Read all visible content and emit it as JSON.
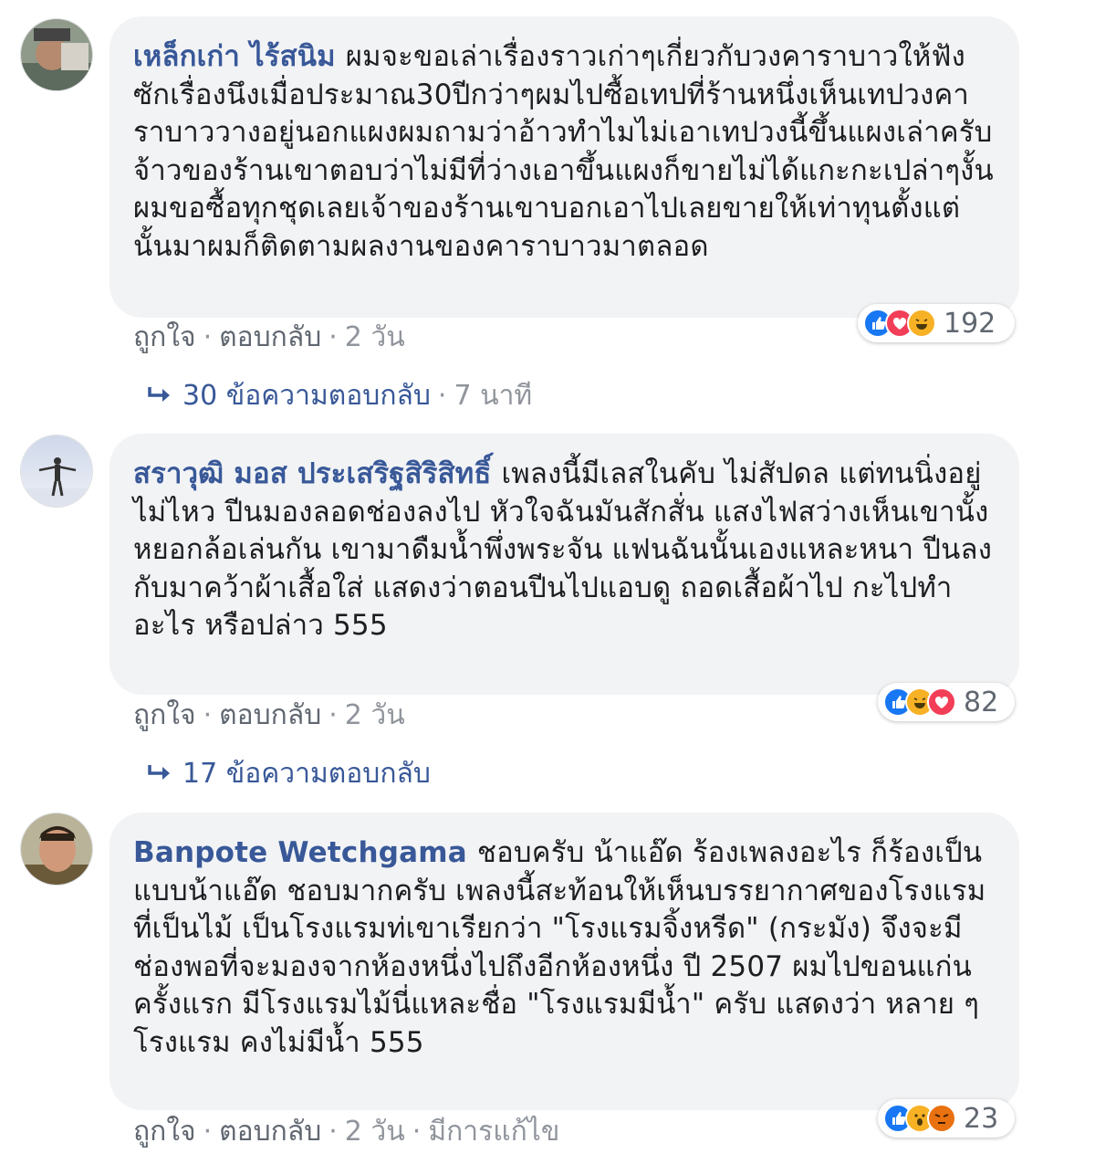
{
  "comments": [
    {
      "author": "เหล็กเก่า ไร้สนิม",
      "text": "ผมจะขอเล่าเรื่องราวเก่าๆเกี่ยวกับวงคาราบาวให้ฟังซักเรื่องนึงเมื่อประมาณ30ปีกว่าๆผมไปซื้อเทปที่ร้านหนึ่งเห็นเทปวงคาราบาววางอยู่นอกแผงผมถามว่าอ้าวทำไมไม่เอาเทปวงนี้ขึ้นแผงเล่าครับจ้าวของร้านเขาตอบว่าไม่มีที่ว่างเอาขึ้นแผงก็ขายไม่ได้แกะกะเปล่าๆงั้นผมขอซื้อทุกชุดเลยเจ้าของร้านเขาบอกเอาไปเลยขายให้เท่าทุนตั้งแต่นั้นมาผมก็ติดตามผลงานของคาราบาวมาตลอด",
      "like": "ถูกใจ",
      "reply": "ตอบกลับ",
      "time": "2 วัน",
      "reaction_count": "192",
      "reaction_icons": [
        "like-icon",
        "love-icon",
        "haha-icon"
      ],
      "replies_label": "30 ข้อความตอบกลับ",
      "replies_time": "7 นาที"
    },
    {
      "author": "สราวุฒิ มอส ประเสริฐสิริสิทธิ์",
      "text": "เพลงนี้มีเลสในคับ ไม่สัปดล แต่ทนนิ่งอยู่ไม่ไหว ปีนมองลอดช่องลงไป หัวใจฉันมันสักสั่น แสงไฟสว่างเห็นเขานั้งหยอกล้อเล่นกัน เขามาดืมน้ำพึ่งพระจัน แฟนฉันนั้นเองแหละหนา ปีนลงกับมาคว้าผ้าเสื้อใส่ แสดงว่าตอนปีนไปแอบดู ถอดเสื้อผ้าไป กะไปทำอะไร หรือปล่าว 555",
      "like": "ถูกใจ",
      "reply": "ตอบกลับ",
      "time": "2 วัน",
      "reaction_count": "82",
      "reaction_icons": [
        "like-icon",
        "haha-icon",
        "love-icon"
      ],
      "replies_label": "17 ข้อความตอบกลับ"
    },
    {
      "author": "Banpote Wetchgama",
      "text": "ชอบครับ น้าแอ๊ด ร้องเพลงอะไร ก็ร้องเป็นแบบน้าแอ๊ด ชอบมากครับ เพลงนี้สะท้อนให้เห็นบรรยากาศของโรงแรมที่เป็นไม้ เป็นโรงแรมท่เขาเรียกว่า \"โรงแรมจิ้งหรีด\" (กระมัง) จึงจะมีช่องพอที่จะมองจากห้องหนึ่งไปถึงอีกห้องหนึ่ง ปี 2507 ผมไปขอนแก่นครั้งแรก มีโรงแรมไม้นี่แหละชื่อ \"โรงแรมมีน้ำ\" ครับ แสดงว่า หลาย ๆ โรงแรม คงไม่มีน้ำ 555",
      "like": "ถูกใจ",
      "reply": "ตอบกลับ",
      "time": "2 วัน",
      "edited": "มีการแก้ไข",
      "reaction_count": "23",
      "reaction_icons": [
        "like-icon",
        "wow-icon",
        "angry-icon"
      ]
    }
  ],
  "colors": {
    "author": "#385898",
    "bubble": "#f2f3f5",
    "meta": "#90949c",
    "like": "#1877f2",
    "love": "#f33e58",
    "haha": "#f7b125",
    "angry": "#e9710f"
  }
}
